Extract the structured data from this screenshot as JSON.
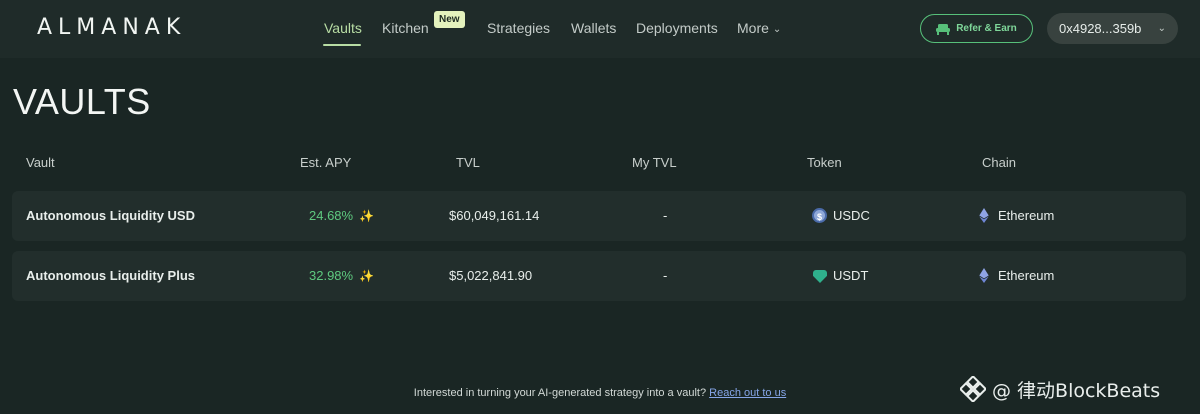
{
  "brand": {
    "logo": "ALMANAK"
  },
  "nav": {
    "items": [
      {
        "label": "Vaults",
        "active": true
      },
      {
        "label": "Kitchen",
        "badge": "New"
      },
      {
        "label": "Strategies"
      },
      {
        "label": "Wallets"
      },
      {
        "label": "Deployments"
      },
      {
        "label": "More"
      }
    ],
    "refer_label": "Refer & Earn",
    "wallet_address": "0x4928...359b"
  },
  "page": {
    "title": "VAULTS"
  },
  "table": {
    "columns": [
      "Vault",
      "Est. APY",
      "TVL",
      "My TVL",
      "Token",
      "Chain"
    ],
    "rows": [
      {
        "vault": "Autonomous Liquidity USD",
        "apy": "24.68%",
        "tvl": "$60,049,161.14",
        "my_tvl": "-",
        "token": "USDC",
        "token_icon": "usdc-icon",
        "chain": "Ethereum",
        "chain_icon": "ethereum-icon"
      },
      {
        "vault": "Autonomous Liquidity Plus",
        "apy": "32.98%",
        "tvl": "$5,022,841.90",
        "my_tvl": "-",
        "token": "USDT",
        "token_icon": "usdt-icon",
        "chain": "Ethereum",
        "chain_icon": "ethereum-icon"
      }
    ]
  },
  "footer": {
    "text": "Interested in turning your AI-generated strategy into a vault?",
    "link": "Reach out to us"
  },
  "watermark": {
    "text": "@ 律动BlockBeats"
  },
  "colors": {
    "background": "#1a2624",
    "accent": "#b8dda4",
    "positive": "#5ec97f",
    "refer": "#57c07a"
  }
}
